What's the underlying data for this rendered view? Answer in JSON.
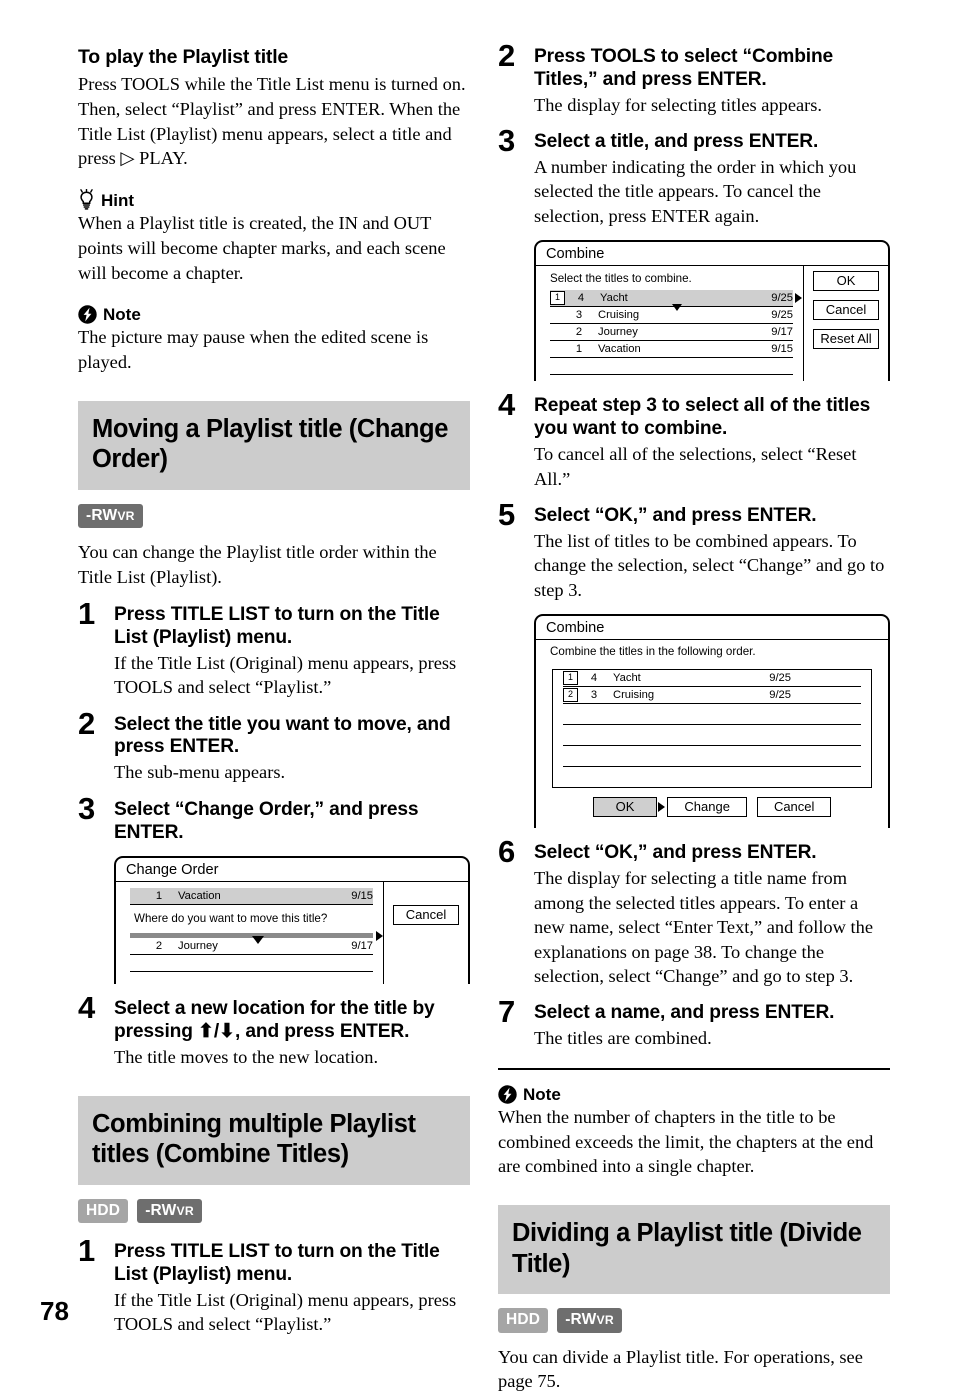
{
  "page": {
    "number": "78"
  },
  "left_column": {
    "intro": {
      "heading": "To play the Playlist title",
      "paragraph": "Press TOOLS while the Title List menu is turned on. Then, select “Playlist” and press ENTER. When the Title List (Playlist) menu appears, select a title and press ▷ PLAY."
    },
    "hint": {
      "icon": "lightbulb-icon",
      "label": "Hint",
      "text": "When a Playlist title is created, the IN and OUT points will become chapter marks, and each scene will become a chapter."
    },
    "note": {
      "icon": "note-bolt-icon",
      "label": "Note",
      "text": "The picture may pause when the edited scene is played."
    },
    "section_change_order": {
      "title": "Moving a Playlist title (Change Order)",
      "badges": [
        {
          "main": "-RW",
          "small": "VR",
          "style": "rwvr"
        }
      ],
      "intro": "You can change the Playlist title order within the Title List (Playlist).",
      "steps": [
        {
          "num": "1",
          "title": "Press TITLE LIST to turn on the Title List (Playlist) menu.",
          "body": "If the Title List (Original) menu appears, press TOOLS and select “Playlist.”"
        },
        {
          "num": "2",
          "title": "Select the title you want to move, and press ENTER.",
          "body": "The sub-menu appears."
        },
        {
          "num": "3",
          "title": "Select “Change Order,” and press ENTER.",
          "body": ""
        },
        {
          "num": "4",
          "title": "Select a new location for the title by pressing ⬆/⬇, and press ENTER.",
          "body": "The title moves to the new location."
        }
      ]
    },
    "screen_change_order": {
      "title": "Change Order",
      "prompt": "Where do you want to move this title?",
      "cancel_label": "Cancel",
      "selected_row": {
        "num": "1",
        "name": "Vacation",
        "date": "9/15"
      },
      "other_row": {
        "num": "2",
        "name": "Journey",
        "date": "9/17"
      }
    },
    "section_combine": {
      "title": "Combining multiple Playlist titles (Combine Titles)",
      "badges": [
        {
          "main": "HDD",
          "small": "",
          "style": "hdd"
        },
        {
          "main": "-RW",
          "small": "VR",
          "style": "rwvr"
        }
      ],
      "steps": [
        {
          "num": "1",
          "title": "Press TITLE LIST to turn on the Title List (Playlist) menu.",
          "body": "If the Title List (Original) menu appears, press TOOLS and select “Playlist.”"
        }
      ]
    }
  },
  "right_column": {
    "steps_top": [
      {
        "num": "2",
        "title": "Press TOOLS to select “Combine Titles,” and press ENTER.",
        "body": "The display for selecting titles appears."
      },
      {
        "num": "3",
        "title": "Select a title, and press ENTER.",
        "body": "A number indicating the order in which you selected the title appears.\nTo cancel the selection, press ENTER again."
      }
    ],
    "screen_combine_select": {
      "title": "Combine",
      "prompt": "Select the titles to combine.",
      "buttons": [
        "OK",
        "Cancel",
        "Reset All"
      ],
      "rows": [
        {
          "order": "1",
          "num": "4",
          "name": "Yacht",
          "date": "9/25",
          "selected": true
        },
        {
          "order": "",
          "num": "3",
          "name": "Cruising",
          "date": "9/25",
          "selected": false
        },
        {
          "order": "",
          "num": "2",
          "name": "Journey",
          "date": "9/17",
          "selected": false
        },
        {
          "order": "",
          "num": "1",
          "name": "Vacation",
          "date": "9/15",
          "selected": false
        }
      ]
    },
    "steps_mid": [
      {
        "num": "4",
        "title": "Repeat step 3 to select all of the titles you want to combine.",
        "body": "To cancel all of the selections, select “Reset All.”"
      },
      {
        "num": "5",
        "title": "Select “OK,” and press ENTER.",
        "body": "The list of titles to be combined appears.\nTo change the selection, select “Change” and go to step 3."
      }
    ],
    "screen_combine_order": {
      "title": "Combine",
      "prompt": "Combine the titles in the following order.",
      "rows": [
        {
          "order": "1",
          "num": "4",
          "name": "Yacht",
          "date": "9/25"
        },
        {
          "order": "2",
          "num": "3",
          "name": "Cruising",
          "date": "9/25"
        }
      ],
      "buttons": [
        "OK",
        "Change",
        "Cancel"
      ]
    },
    "steps_bottom": [
      {
        "num": "6",
        "title": "Select “OK,” and press ENTER.",
        "body": "The display for selecting a title name from among the selected titles appears.\nTo enter a new name, select “Enter Text,” and follow the explanations on page 38.\nTo change the selection, select “Change” and go to step 3."
      },
      {
        "num": "7",
        "title": "Select a name, and press ENTER.",
        "body": "The titles are combined."
      }
    ],
    "note": {
      "icon": "note-bolt-icon",
      "label": "Note",
      "text": "When the number of chapters in the title to be combined exceeds the limit, the chapters at the end are combined into a single chapter."
    },
    "section_divide": {
      "title": "Dividing a Playlist title (Divide Title)",
      "badges": [
        {
          "main": "HDD",
          "small": "",
          "style": "hdd"
        },
        {
          "main": "-RW",
          "small": "VR",
          "style": "rwvr"
        }
      ],
      "intro": "You can divide a Playlist title. For operations, see page 75."
    }
  }
}
